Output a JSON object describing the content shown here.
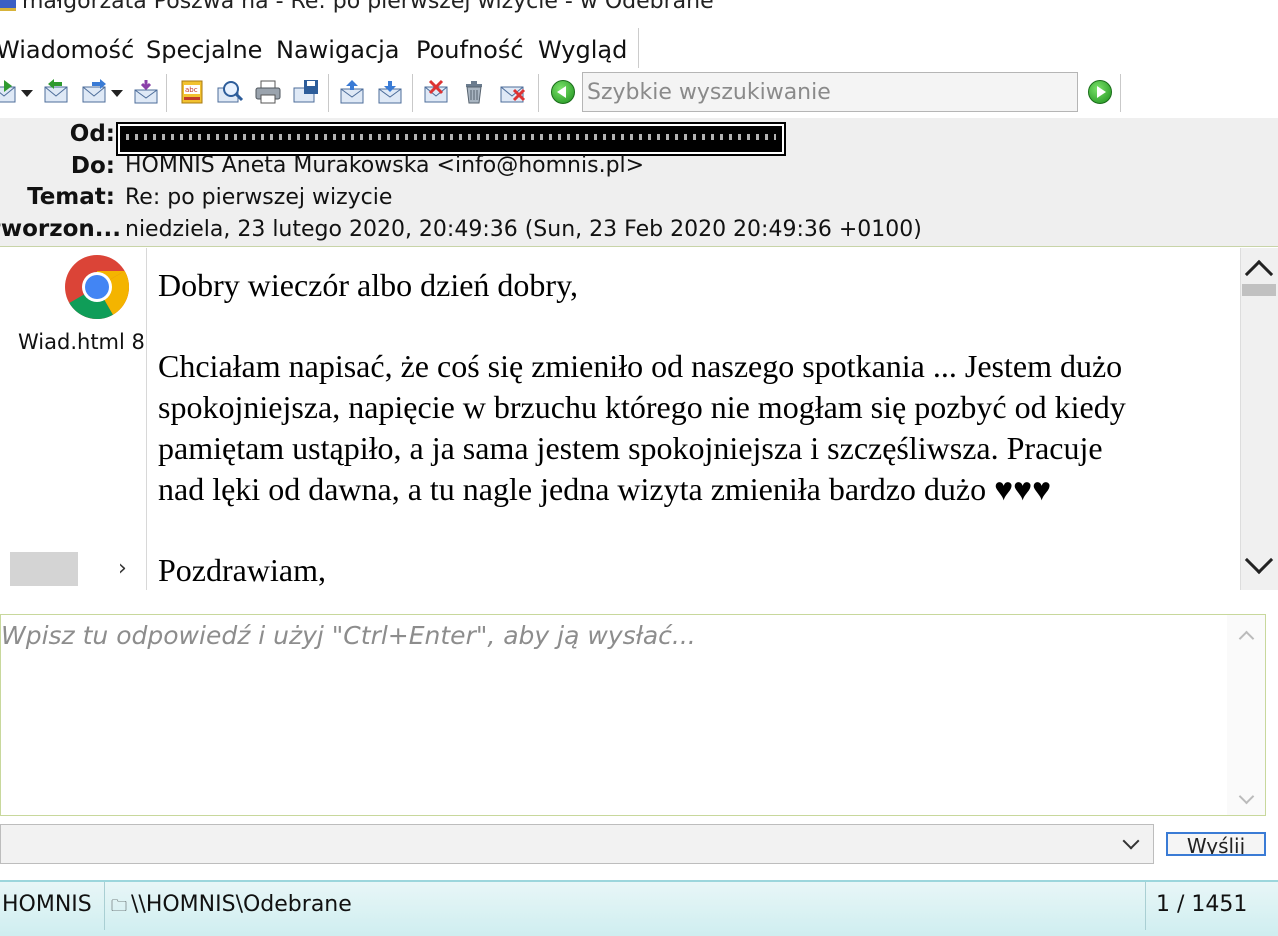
{
  "window": {
    "title": "małgorzata Poszwa na - Re: po pierwszej wizycie - w Odebrane"
  },
  "menu": [
    "Wiadomość",
    "Specjalne",
    "Nawigacja",
    "Poufność",
    "Wygląd"
  ],
  "search": {
    "placeholder": "Szybkie wyszukiwanie"
  },
  "header": {
    "from_label": "Od:",
    "to_label": "Do:",
    "to_value": "HOMNIS Aneta Murakowska <info@homnis.pl>",
    "subject_label": "Temat:",
    "subject_value": "Re: po pierwszej wizycie",
    "created_label": "tworzon...",
    "created_value": "niedziela, 23 lutego 2020, 20:49:36  (Sun, 23 Feb 2020 20:49:36 +0100)"
  },
  "attachment": {
    "name": "Wiad.html 8",
    "icon": "chrome-icon"
  },
  "message": {
    "lines": [
      "Dobry wieczór albo dzień dobry,",
      "Chciałam napisać, że coś się zmieniło od naszego spotkania ... Jestem dużo",
      "spokojniejsza, napięcie w brzuchu którego nie mogłam się pozbyć od kiedy",
      "pamiętam ustąpiło, a ja sama jestem spokojniejsza i szczęśliwsza.  Pracuje",
      "nad lęki od dawna, a tu nagle jedna wizyta zmieniła bardzo dużo ♥♥♥",
      "Pozdrawiam,"
    ]
  },
  "reply": {
    "placeholder": "Wpisz tu odpowiedź i użyj \"Ctrl+Enter\", aby ją wysłać..."
  },
  "send_label": "Wyślij",
  "status": {
    "account": "HOMNIS",
    "folder": "\\\\HOMNIS\\Odebrane",
    "count": "1 / 1451"
  },
  "colors": {
    "accent_green": "#1b8e1b",
    "header_bg": "#efefef",
    "status_bg": "#cfeef0",
    "focus_blue": "#3a7bd5"
  }
}
